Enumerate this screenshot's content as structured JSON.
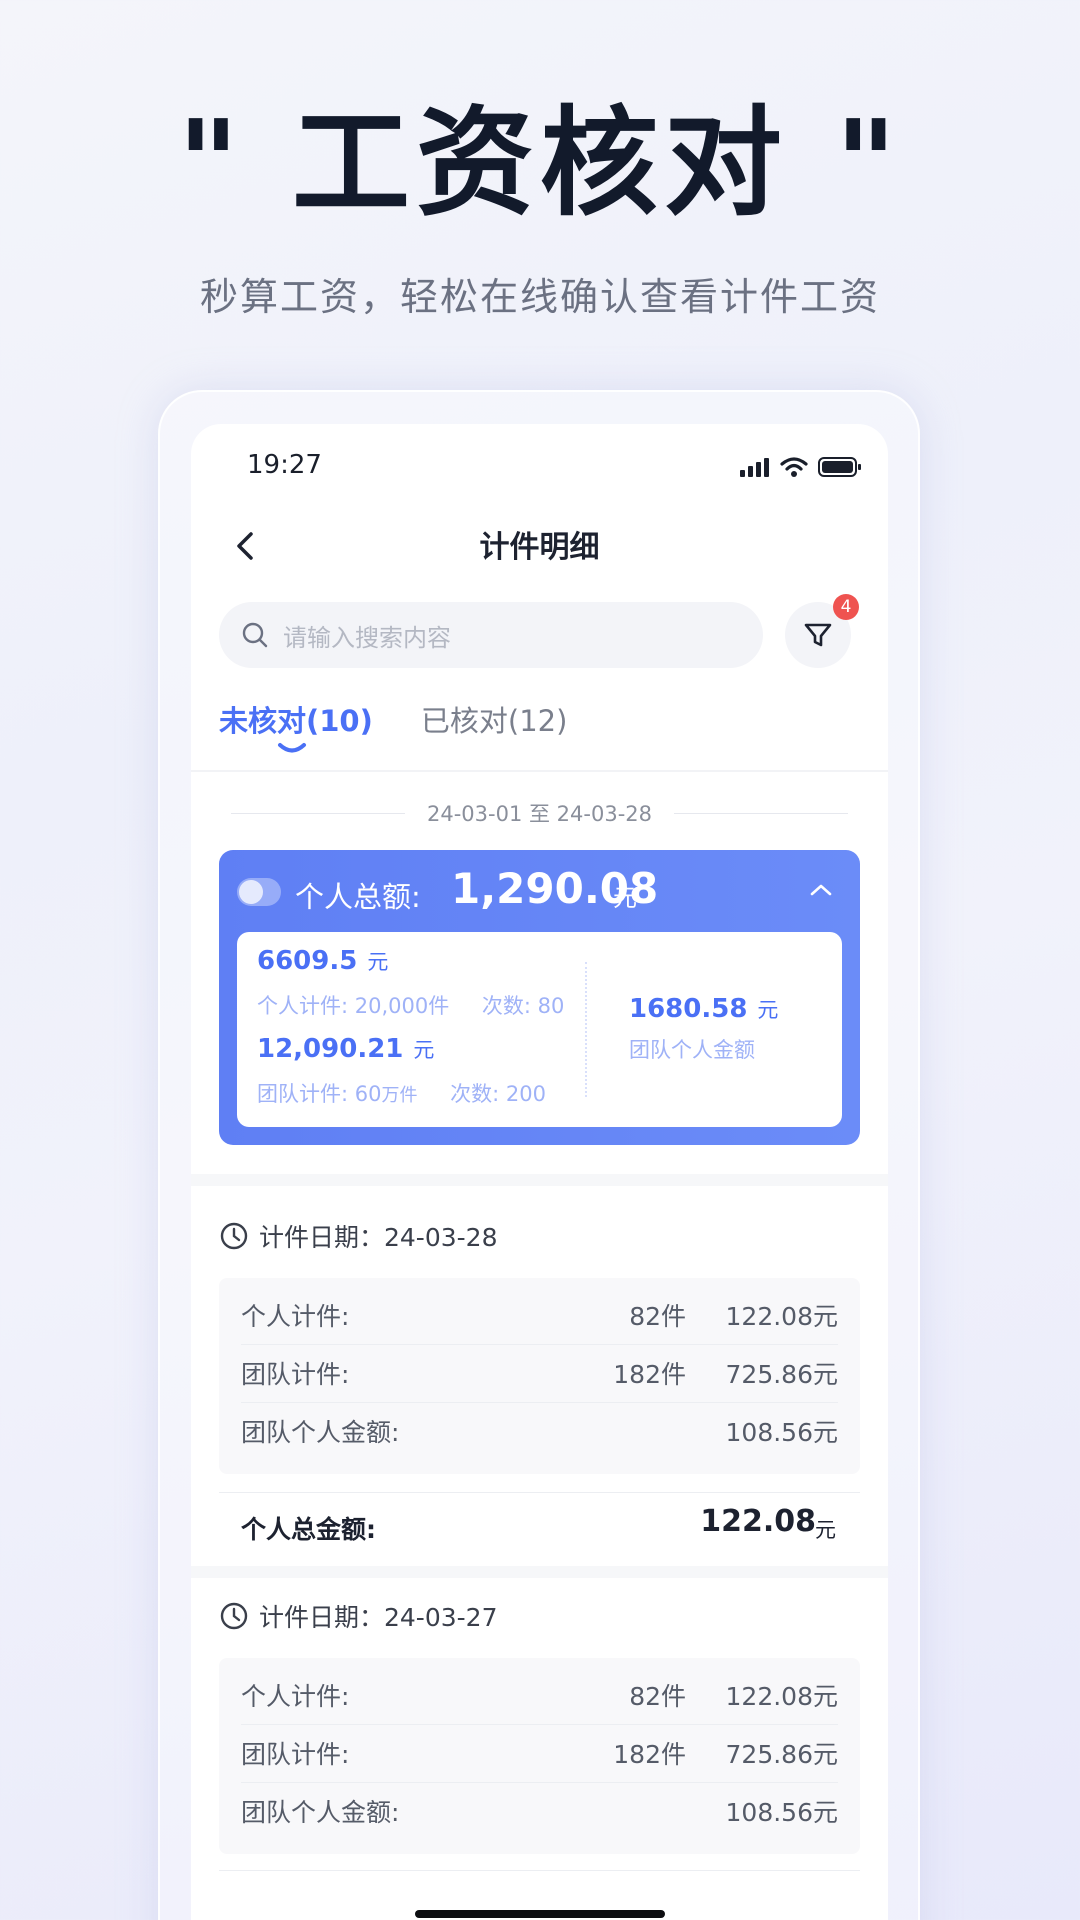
{
  "promo": {
    "headline": "\" 工资核对 \"",
    "subline": "秒算工资，轻松在线确认查看计件工资"
  },
  "status_bar": {
    "time": "19:27"
  },
  "nav": {
    "title": "计件明细"
  },
  "search": {
    "placeholder": "请输入搜索内容"
  },
  "filter": {
    "badge": "4"
  },
  "tabs": [
    {
      "label": "未核对(10)",
      "active": true
    },
    {
      "label": "已核对(12)",
      "active": false
    }
  ],
  "date_range": "24-03-01 至 24-03-28",
  "summary": {
    "label": "个人总额:",
    "amount": "1,290.08",
    "unit": "元",
    "personal_amount": "6609.5",
    "personal_detail_1": "个人计件: 20,000件",
    "personal_detail_2": "次数: 80",
    "team_amount": "12,090.21",
    "team_detail_1a": "团队计件: 60",
    "team_detail_1b": "万件",
    "team_detail_2": "次数: 200",
    "team_personal_amount": "1680.58",
    "team_personal_label": "团队个人金额"
  },
  "days": [
    {
      "date_label": "计件日期：24-03-28",
      "rows": [
        {
          "name": "个人计件:",
          "count": "82件",
          "money": "122.08元"
        },
        {
          "name": "团队计件:",
          "count": "182件",
          "money": "725.86元"
        },
        {
          "name": "团队个人金额:",
          "count": "",
          "money": "108.56元"
        }
      ],
      "total_label": "个人总金额:",
      "total_value": "122.08",
      "total_unit": "元"
    },
    {
      "date_label": "计件日期：24-03-27",
      "rows": [
        {
          "name": "个人计件:",
          "count": "82件",
          "money": "122.08元"
        },
        {
          "name": "团队计件:",
          "count": "182件",
          "money": "725.86元"
        },
        {
          "name": "团队个人金额:",
          "count": "",
          "money": "108.56元"
        }
      ]
    }
  ],
  "colors": {
    "accent": "#4a70f5",
    "summary_bg": "#5f7ff4",
    "badge": "#ef5350",
    "headline": "#121a2b"
  }
}
